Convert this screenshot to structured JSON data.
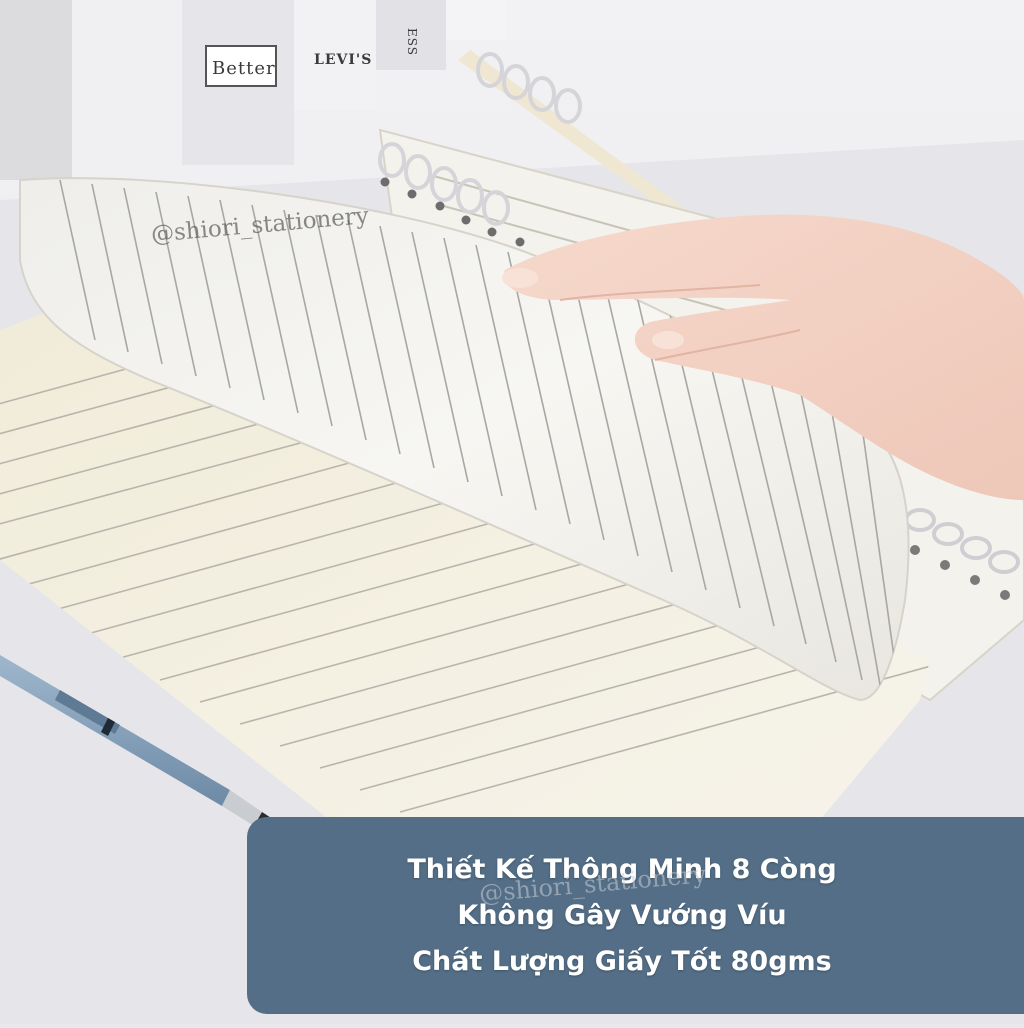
{
  "photo": {
    "spine_labels": [
      "Better",
      "LEVI'S",
      "ESS"
    ],
    "watermark_top": "@shiori_stationery",
    "watermark_banner": "@shiori_stationery"
  },
  "banner": {
    "lines": [
      "Thiết Kế Thông Minh 8 Còng",
      "Không Gây Vướng Víu",
      "Chất Lượng Giấy Tốt 80gms"
    ],
    "background_color": "#536e86",
    "text_color": "#ffffff"
  }
}
